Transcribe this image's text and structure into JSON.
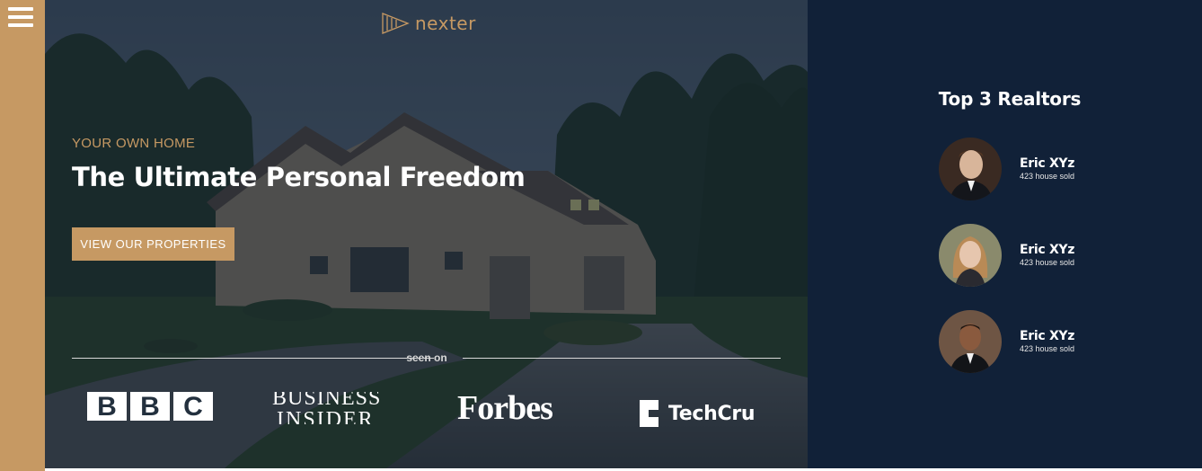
{
  "menu": {
    "icon": "hamburger-menu-icon"
  },
  "brand": {
    "name": "nexter",
    "icon": "nexter-logo-icon",
    "color": "#c69963"
  },
  "hero": {
    "subtitle": "YOUR OWN HOME",
    "title": "The Ultimate Personal Freedom",
    "cta_label": "VIEW OUR PROPERTIES",
    "seen_on": "seen on"
  },
  "press": [
    {
      "name": "BBC",
      "letters": [
        "B",
        "B",
        "C"
      ]
    },
    {
      "name": "BUSINESS INSIDER",
      "line1": "BUSINESS",
      "line2": "INSIDER"
    },
    {
      "name": "Forbes"
    },
    {
      "name": "TechCrunch",
      "visible": "TechCru"
    }
  ],
  "realtors": {
    "title": "Top 3 Realtors",
    "items": [
      {
        "name": "Eric XYz",
        "sold": "423 house sold"
      },
      {
        "name": "Eric XYz",
        "sold": "423 house sold"
      },
      {
        "name": "Eric XYz",
        "sold": "423 house sold"
      }
    ]
  },
  "colors": {
    "accent": "#c69963",
    "panel": "#112138",
    "overlay": "#101d2c"
  }
}
